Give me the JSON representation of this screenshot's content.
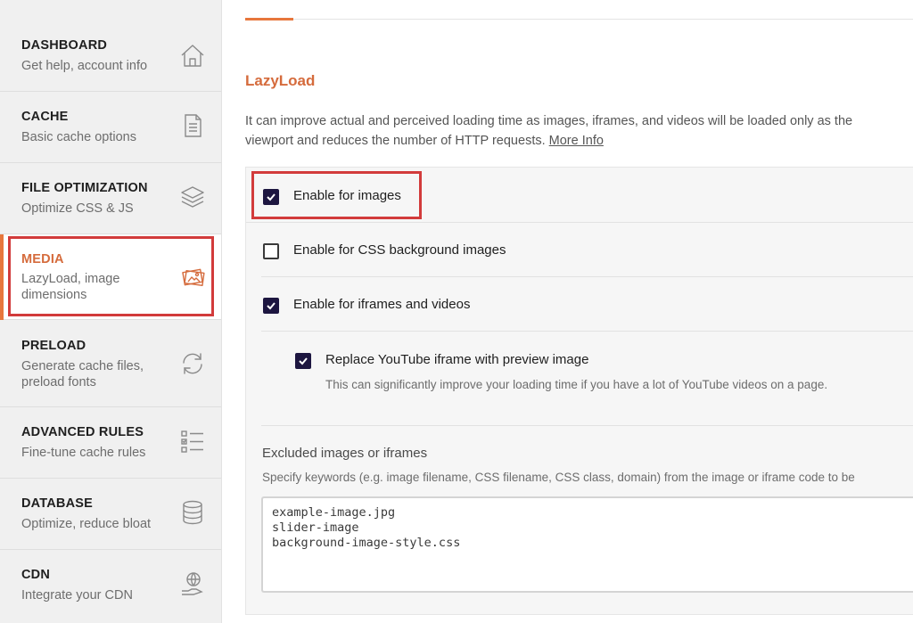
{
  "sidebar": {
    "items": [
      {
        "title": "DASHBOARD",
        "subtitle": "Get help, account info",
        "icon": "home-icon"
      },
      {
        "title": "CACHE",
        "subtitle": "Basic cache options",
        "icon": "document-icon"
      },
      {
        "title": "FILE OPTIMIZATION",
        "subtitle": "Optimize CSS & JS",
        "icon": "layers-icon"
      },
      {
        "title": "MEDIA",
        "subtitle_line1": "LazyLoad, image",
        "subtitle_line2": "dimensions",
        "icon": "images-icon",
        "active": true
      },
      {
        "title": "PRELOAD",
        "subtitle_line1": "Generate cache files,",
        "subtitle_line2": "preload fonts",
        "icon": "refresh-icon"
      },
      {
        "title": "ADVANCED RULES",
        "subtitle": "Fine-tune cache rules",
        "icon": "checklist-icon"
      },
      {
        "title": "DATABASE",
        "subtitle": "Optimize, reduce bloat",
        "icon": "database-icon"
      },
      {
        "title": "CDN",
        "subtitle": "Integrate your CDN",
        "icon": "globe-hand-icon"
      }
    ]
  },
  "main": {
    "section_title": "LazyLoad",
    "description_line1": "It can improve actual and perceived loading time as images, iframes, and videos will be loaded only as the",
    "description_line2": "viewport and reduces the number of HTTP requests.",
    "more_info": "More Info",
    "options": [
      {
        "label": "Enable for images",
        "checked": true
      },
      {
        "label": "Enable for CSS background images",
        "checked": false
      },
      {
        "label": "Enable for iframes and videos",
        "checked": true
      }
    ],
    "sub_option": {
      "label": "Replace YouTube iframe with preview image",
      "hint": "This can significantly improve your loading time if you have a lot of YouTube videos on a page.",
      "checked": true
    },
    "excluded": {
      "label": "Excluded images or iframes",
      "hint": "Specify keywords (e.g. image filename, CSS filename, CSS class, domain) from the image or iframe code to be",
      "lines": [
        "example-image.jpg",
        "slider-image",
        "background-image-style.css"
      ]
    }
  },
  "colors": {
    "accent": "#e7763c",
    "accent_text": "#d56b3c",
    "highlight_box": "#d23b3b",
    "checkbox_checked": "#1d1640"
  }
}
